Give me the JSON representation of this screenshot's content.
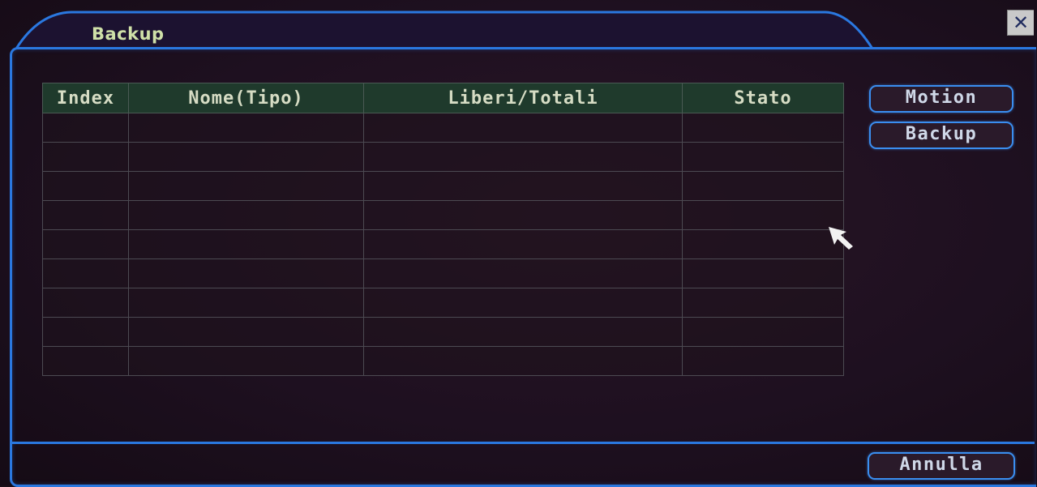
{
  "window": {
    "title": "Backup",
    "close_label": "✕"
  },
  "table": {
    "columns": [
      "Index",
      "Nome(Tipo)",
      "Liberi/Totali",
      "Stato"
    ],
    "rows": []
  },
  "buttons": {
    "motion": "Motion",
    "backup": "Backup",
    "annulla": "Annulla"
  },
  "colors": {
    "accent": "#2a78e0",
    "header_bg": "#1f3a2c",
    "background": "#1e1020",
    "title_text": "#cfe0a8"
  }
}
